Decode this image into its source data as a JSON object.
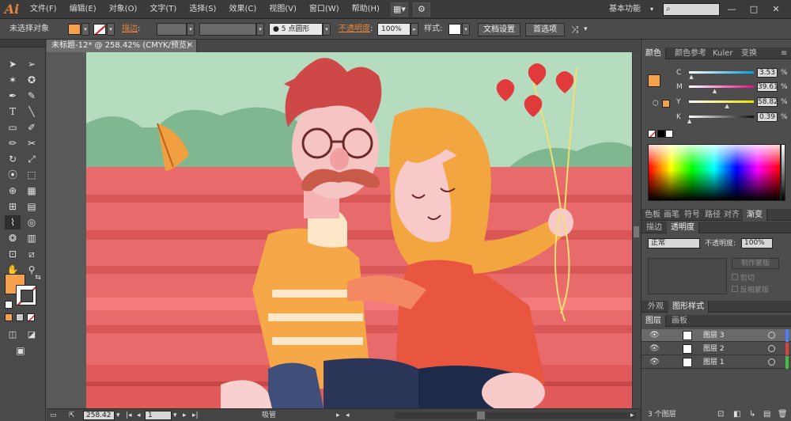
{
  "app": {
    "logo": "Ai"
  },
  "menu": [
    "文件(F)",
    "编辑(E)",
    "对象(O)",
    "文字(T)",
    "选择(S)",
    "效果(C)",
    "视图(V)",
    "窗口(W)",
    "帮助(H)"
  ],
  "menubar": {
    "workspace": "基本功能",
    "workspace_caret": "▾",
    "search_placeholder": "",
    "arrange_icon": "▦▾",
    "gpu_icon": "⚙",
    "minimize": "—",
    "restore": "□",
    "close": "✕"
  },
  "control": {
    "selection": "未选择对象",
    "stroke_label": "描边",
    "stroke_colon": ":",
    "brush_value": "5 点圆形",
    "brush_dot": "●",
    "opacity_label": "不透明度",
    "opacity_colon": ":",
    "opacity_value": "100%",
    "style_label": "样式:",
    "doc_setup": "文档设置",
    "prefs": "首选项",
    "fill_color": "#f5a04b",
    "stroke_color": "#ffffff"
  },
  "document": {
    "tab_title": "未标题-12* @ 258.42% (CMYK/预览)",
    "tab_close": "✕"
  },
  "status": {
    "zoom": "258.42",
    "page": "1",
    "tool_name": "吸管"
  },
  "color_panel": {
    "tabs": [
      "颜色",
      "颜色参考",
      "Kuler",
      "变换"
    ],
    "channels": [
      {
        "label": "C",
        "value": "3.53",
        "start": "#ffffff",
        "end": "#00a0e0",
        "pos": 0.04
      },
      {
        "label": "M",
        "value": "39.61",
        "start": "#ffffff",
        "end": "#e0108a",
        "pos": 0.4
      },
      {
        "label": "Y",
        "value": "58.82",
        "start": "#ffffff",
        "end": "#f0e000",
        "pos": 0.59
      },
      {
        "label": "K",
        "value": "0.39",
        "start": "#ffffff",
        "end": "#111111",
        "pos": 0.01
      }
    ]
  },
  "transparency_panel": {
    "tabs_top": [
      "色板",
      "画笔",
      "符号",
      "路径",
      "对齐",
      "渐变"
    ],
    "tabs": [
      "描边",
      "透明度"
    ],
    "blend_mode": "正常",
    "opacity_label": "不透明度:",
    "opacity_value": "100%",
    "make_mask": "制作蒙版",
    "clip": "剪切",
    "invert_mask": "反相蒙版"
  },
  "appearance_tabs": [
    "外观",
    "图形样式"
  ],
  "layers_panel": {
    "tabs": [
      "图层",
      "画板"
    ],
    "layers": [
      {
        "name": "图层 3",
        "color": "#4c7dff"
      },
      {
        "name": "图层 2",
        "color": "#e04040"
      },
      {
        "name": "图层 1",
        "color": "#40c040"
      }
    ],
    "footer": "3 个图层"
  }
}
